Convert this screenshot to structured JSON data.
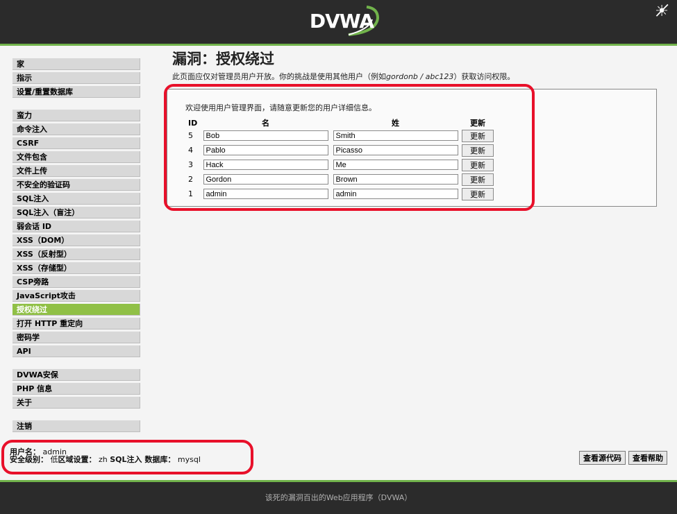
{
  "header": {
    "logo_text": "DVWA",
    "theme_icon": "light-dark-toggle-icon"
  },
  "sidebar": {
    "groups": [
      [
        "家",
        "指示",
        "设置/重置数据库"
      ],
      [
        "蛮力",
        "命令注入",
        "CSRF",
        "文件包含",
        "文件上传",
        "不安全的验证码",
        "SQL注入",
        "SQL注入（盲注）",
        "弱会话 ID",
        "XSS（DOM）",
        "XSS（反射型）",
        "XSS（存储型）",
        "CSP旁路",
        "JavaScript攻击",
        "授权绕过",
        "打开 HTTP 重定向",
        "密码学",
        "API"
      ],
      [
        "DVWA安保",
        "PHP 信息",
        "关于"
      ],
      [
        "注销"
      ]
    ],
    "active": "授权绕过"
  },
  "main": {
    "title": "漏洞：授权绕过",
    "intro_prefix": "此页面应仅对管理员用户开放。你的挑战是使用其他用户（例如",
    "intro_example": "gordonb / abc123",
    "intro_suffix": "）获取访问权限。",
    "welcome": "欢迎使用用户管理界面，请随意更新您的用户详细信息。",
    "table": {
      "headers": {
        "id": "ID",
        "first": "名",
        "last": "姓",
        "update": "更新"
      },
      "rows": [
        {
          "id": "5",
          "first": "Bob",
          "last": "Smith",
          "button": "更新"
        },
        {
          "id": "4",
          "first": "Pablo",
          "last": "Picasso",
          "button": "更新"
        },
        {
          "id": "3",
          "first": "Hack",
          "last": "Me",
          "button": "更新"
        },
        {
          "id": "2",
          "first": "Gordon",
          "last": "Brown",
          "button": "更新"
        },
        {
          "id": "1",
          "first": "admin",
          "last": "admin",
          "button": "更新"
        }
      ]
    }
  },
  "status": {
    "username_label": "用户名：",
    "username": "admin",
    "security_label": "安全级别：",
    "security": "低",
    "locale_label": "区域设置：",
    "locale": "zh",
    "sqli_label": "SQL注入 数据库：",
    "sqli_db": "mysql"
  },
  "buttons": {
    "view_source": "查看源代码",
    "view_help": "查看帮助"
  },
  "footer": {
    "text": "该死的漏洞百出的Web应用程序（DVWA）"
  },
  "colors": {
    "accent": "#90c046",
    "header_bg": "#2b2b2b",
    "highlight": "#e8102a"
  }
}
